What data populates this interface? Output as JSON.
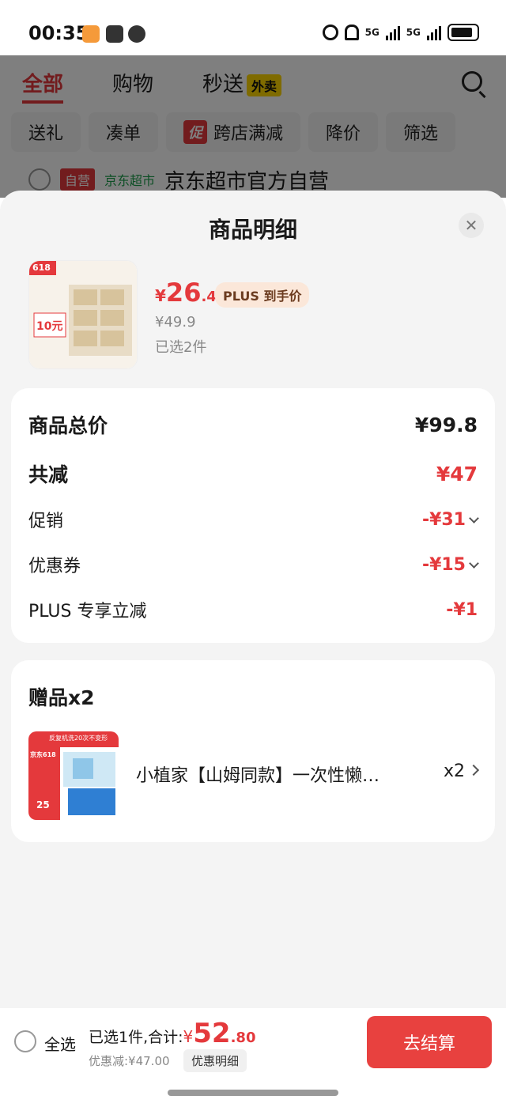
{
  "status_bar": {
    "time": "00:35",
    "net1": "5G",
    "net2": "5G"
  },
  "background_page": {
    "tabs": [
      "全部",
      "购物",
      "秒送"
    ],
    "waimai_badge": "外卖",
    "filters": [
      "送礼",
      "凑单",
      "跨店满减",
      "降价",
      "筛选"
    ],
    "promo_tag": "促",
    "store": {
      "tag_self": "自营",
      "tag_jd": "京东超市",
      "name": "京东超市官方自营"
    }
  },
  "sheet": {
    "title": "商品明细",
    "close_icon": "✕",
    "product": {
      "yen": "¥",
      "price_int": "26",
      "price_dec": ".4",
      "plus_tag": "PLUS 到手价",
      "orig_price": "¥49.9",
      "selected": "已选2件",
      "img_text_618": "618",
      "img_text_promo": "10元"
    },
    "summary": {
      "total_label": "商品总价",
      "total_value": "¥99.8",
      "reduce_label": "共减",
      "reduce_value": "¥47",
      "promo_label": "促销",
      "promo_value": "-¥31",
      "coupon_label": "优惠券",
      "coupon_value": "-¥15",
      "plus_label": "PLUS 专享立减",
      "plus_value": "-¥1"
    },
    "gift": {
      "title": "赠品x2",
      "name": "小植家【山姆同款】一次性懒人抹布",
      "qty": "x2",
      "img_text_top": "反复机洗20次不变形",
      "img_text_618": "京东618",
      "img_text_price": "25"
    }
  },
  "bottom_bar": {
    "select_all": "全选",
    "summary_prefix": "已选1件,合计:",
    "yen": "¥",
    "total_int": "52",
    "total_dec": ".80",
    "discount": "优惠减:¥47.00",
    "detail_button": "优惠明细",
    "checkout": "去结算"
  },
  "colors": {
    "accent": "#e4393c",
    "plus_bg": "#fbe7d9",
    "jd_green": "#1b9e4b"
  }
}
